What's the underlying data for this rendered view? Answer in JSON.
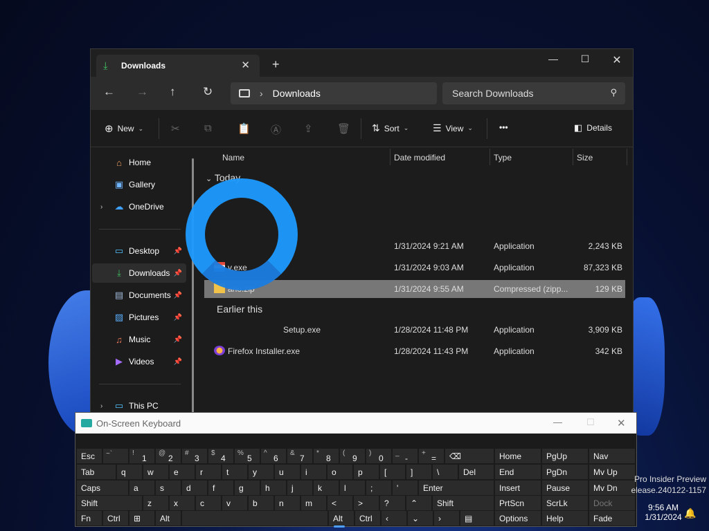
{
  "explorer": {
    "tab_title": "Downloads",
    "address": "Downloads",
    "search_placeholder": "Search Downloads",
    "toolbar": {
      "new": "New",
      "sort": "Sort",
      "view": "View",
      "more": "•••",
      "details": "Details"
    },
    "sidebar": [
      {
        "label": "Home",
        "icon": "home-icon"
      },
      {
        "label": "Gallery",
        "icon": "gallery-icon"
      },
      {
        "label": "OneDrive",
        "icon": "cloud-icon"
      },
      {
        "label": "Desktop",
        "icon": "desktop-icon"
      },
      {
        "label": "Downloads",
        "icon": "download-icon"
      },
      {
        "label": "Documents",
        "icon": "document-icon"
      },
      {
        "label": "Pictures",
        "icon": "picture-icon"
      },
      {
        "label": "Music",
        "icon": "music-icon"
      },
      {
        "label": "Videos",
        "icon": "video-icon"
      },
      {
        "label": "This PC",
        "icon": "pc-icon"
      }
    ],
    "columns": [
      "Name",
      "Date modified",
      "Type",
      "Size"
    ],
    "groups": [
      "Today",
      "Earlier this"
    ],
    "files": [
      {
        "name": "",
        "date": "1/31/2024 9:21 AM",
        "type": "Application",
        "size": "2,243 KB"
      },
      {
        "name": "v.exe",
        "date": "1/31/2024 9:03 AM",
        "type": "Application",
        "size": "87,323 KB"
      },
      {
        "name": "ano.zip",
        "date": "1/31/2024 9:55 AM",
        "type": "Compressed (zipp...",
        "size": "129 KB"
      },
      {
        "name": "Setup.exe",
        "date": "1/28/2024 11:48 PM",
        "type": "Application",
        "size": "3,909 KB"
      },
      {
        "name": "Firefox Installer.exe",
        "date": "1/28/2024 11:43 PM",
        "type": "Application",
        "size": "342 KB"
      }
    ]
  },
  "osk": {
    "title": "On-Screen Keyboard",
    "row1": [
      "Esc",
      "1",
      "2",
      "3",
      "4",
      "5",
      "6",
      "7",
      "8",
      "9",
      "0",
      "-",
      "="
    ],
    "row1_shift": [
      "~`",
      "!",
      "@",
      "#",
      "$",
      "%",
      "^",
      "&",
      "*",
      "(",
      ")",
      "_",
      "+"
    ],
    "row2": [
      "Tab",
      "q",
      "w",
      "e",
      "r",
      "t",
      "y",
      "u",
      "i",
      "o",
      "p",
      "[",
      "]",
      "\\",
      "Del"
    ],
    "row3": [
      "Caps",
      "a",
      "s",
      "d",
      "f",
      "g",
      "h",
      "j",
      "k",
      "l",
      ";",
      "'",
      "Enter"
    ],
    "row4": [
      "Shift",
      "z",
      "x",
      "c",
      "v",
      "b",
      "n",
      "m",
      "<",
      ">",
      "?",
      "Shift"
    ],
    "row5": [
      "Fn",
      "Ctrl",
      "Alt",
      "Alt",
      "Ctrl"
    ],
    "nav": [
      [
        "Home",
        "PgUp",
        "Nav"
      ],
      [
        "End",
        "PgDn",
        "Mv Up"
      ],
      [
        "Insert",
        "Pause",
        "Mv Dn"
      ],
      [
        "PrtScn",
        "ScrLk",
        "Dock"
      ],
      [
        "Options",
        "Help",
        "Fade"
      ]
    ]
  },
  "taskbar": {
    "build_line1": "Pro Insider Preview",
    "build_line2": "elease.240122-1157",
    "time": "9:56 AM",
    "date": "1/31/2024"
  }
}
